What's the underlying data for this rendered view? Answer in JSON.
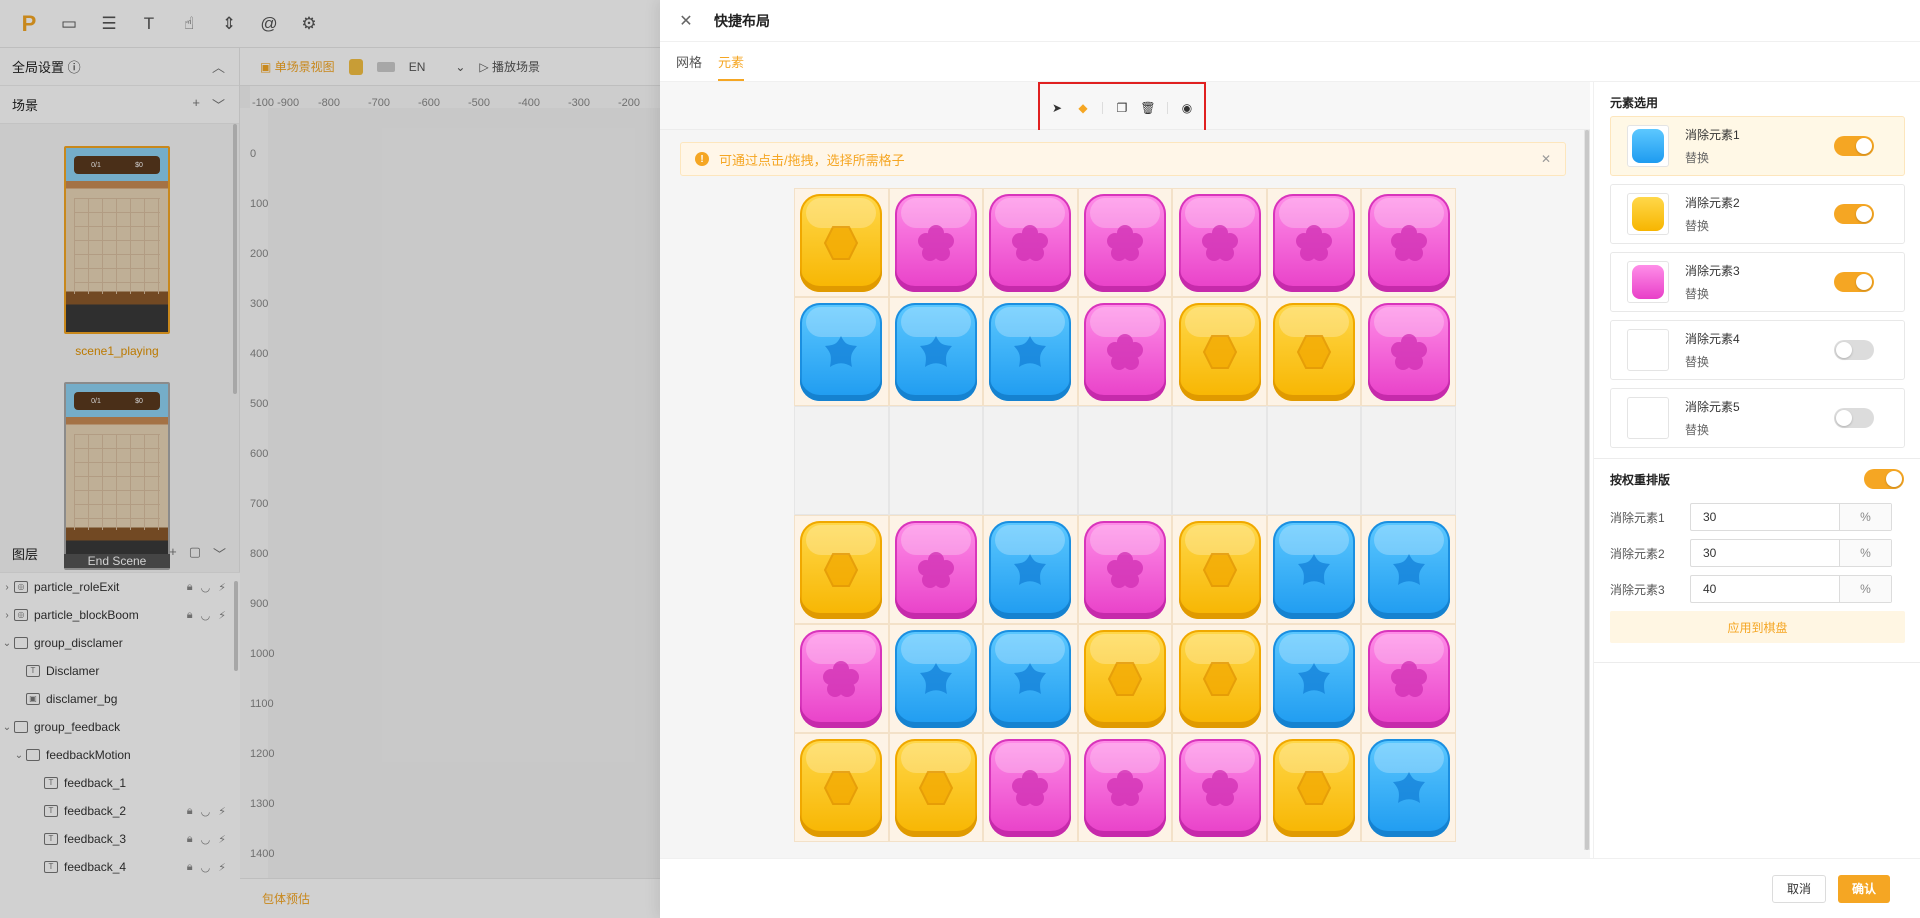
{
  "editor": {
    "global_settings": "全局设置 ⓘ",
    "scenes_label": "场景",
    "scenes": [
      "scene1_playing",
      "End Scene"
    ],
    "scene_hud_left": "0/1",
    "scene_hud_right": "$0",
    "layers_label": "图层",
    "layers": [
      "particle_roleExit",
      "particle_blockBoom",
      "group_disclamer",
      "Disclamer",
      "disclamer_bg",
      "group_feedback",
      "feedbackMotion",
      "feedback_1",
      "feedback_2",
      "feedback_3",
      "feedback_4"
    ],
    "single_scene_view": "单场景视图",
    "language": "EN",
    "play_scene": "播放场景",
    "ruler_x": [
      "-100 -900",
      "-800",
      "-700",
      "-600",
      "-500",
      "-400",
      "-300",
      "-200"
    ],
    "ruler_y": [
      "0",
      "100",
      "200",
      "300",
      "400",
      "500",
      "600",
      "700",
      "800",
      "900",
      "1000",
      "1100",
      "1200",
      "1300",
      "1400"
    ],
    "package_estimate": "包体预估"
  },
  "modal": {
    "title": "快捷布局",
    "tabs": [
      "网格",
      "元素"
    ],
    "tip": "可通过点击/拖拽，选择所需格子",
    "elements_title": "元素选用",
    "elements": [
      {
        "name": "消除元素1",
        "sub": "替换",
        "color": "blue",
        "enabled": true,
        "selected": true
      },
      {
        "name": "消除元素2",
        "sub": "替换",
        "color": "yellow",
        "enabled": true,
        "selected": false
      },
      {
        "name": "消除元素3",
        "sub": "替换",
        "color": "pink",
        "enabled": true,
        "selected": false
      },
      {
        "name": "消除元素4",
        "sub": "替换",
        "color": "",
        "enabled": false,
        "selected": false
      },
      {
        "name": "消除元素5",
        "sub": "替换",
        "color": "",
        "enabled": false,
        "selected": false
      }
    ],
    "weight_title": "按权重排版",
    "weights": [
      {
        "label": "消除元素1",
        "value": "30",
        "unit": "%"
      },
      {
        "label": "消除元素2",
        "value": "30",
        "unit": "%"
      },
      {
        "label": "消除元素3",
        "value": "40",
        "unit": "%"
      }
    ],
    "apply_label": "应用到棋盘",
    "cancel": "取消",
    "confirm": "确认",
    "board": [
      [
        "Y",
        "P",
        "P",
        "P",
        "P",
        "P",
        "P"
      ],
      [
        "B",
        "B",
        "B",
        "P",
        "Y",
        "Y",
        "P"
      ],
      [
        "",
        "",
        "",
        "",
        "",
        "",
        ""
      ],
      [
        "Y",
        "P",
        "B",
        "P",
        "Y",
        "B",
        "B"
      ],
      [
        "P",
        "B",
        "B",
        "Y",
        "Y",
        "B",
        "P"
      ],
      [
        "Y",
        "Y",
        "P",
        "P",
        "P",
        "Y",
        "B"
      ]
    ],
    "tile_colors": {
      "Y": "yellow",
      "P": "pink",
      "B": "blue"
    }
  }
}
